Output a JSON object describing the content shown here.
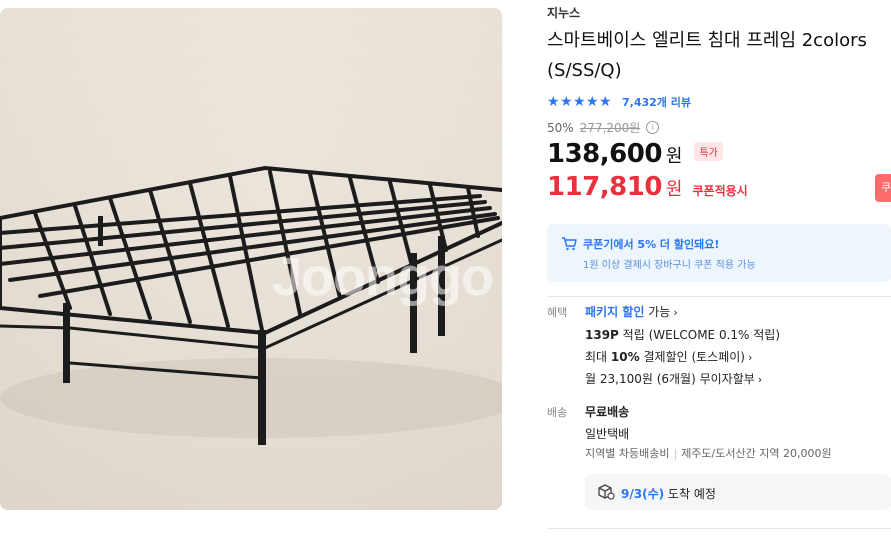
{
  "product_image": {
    "alt": "black metal bed frame",
    "watermark": "Joonggo"
  },
  "seller": "지누스",
  "title": "스마트베이스 엘리트 침대 프레임 2colors (S/SS/Q)",
  "rating": {
    "stars": 4.5,
    "review_count": "7,432개 리뷰"
  },
  "pricing": {
    "discount_rate": "50%",
    "original_price": "277,200원",
    "price": "138,600",
    "price_unit": "원",
    "badge": "특가",
    "coupon_price": "117,810",
    "coupon_unit": "원",
    "coupon_label": "쿠폰적용시",
    "coupon_button": "쿠"
  },
  "promo": {
    "title": "쿠폰기에서 5% 더 할인돼요!",
    "subtitle": "1원 이상 결제시 장바구니 쿠폰 적용 가능"
  },
  "benefits": {
    "label": "혜택",
    "package_link": "패키지 할인",
    "package_suffix": "가능",
    "points_bold": "139P",
    "points_text": "적립 (WELCOME 0.1% 적립)",
    "card_prefix": "최대",
    "card_bold": "10%",
    "card_text": "결제할인 (토스페이)",
    "installment": "월 23,100원 (6개월) 무이자할부"
  },
  "shipping": {
    "label": "배송",
    "type": "무료배송",
    "method": "일반택배",
    "regional_fee": "지역별 차등배송비",
    "jeju_fee": "제주도/도서산간 지역 20,000원",
    "delivery_date": "9/3(수)",
    "delivery_suffix": "도착 예정"
  },
  "colors": {
    "accent_blue": "#2b75f6",
    "sale_red": "#e9313e"
  }
}
